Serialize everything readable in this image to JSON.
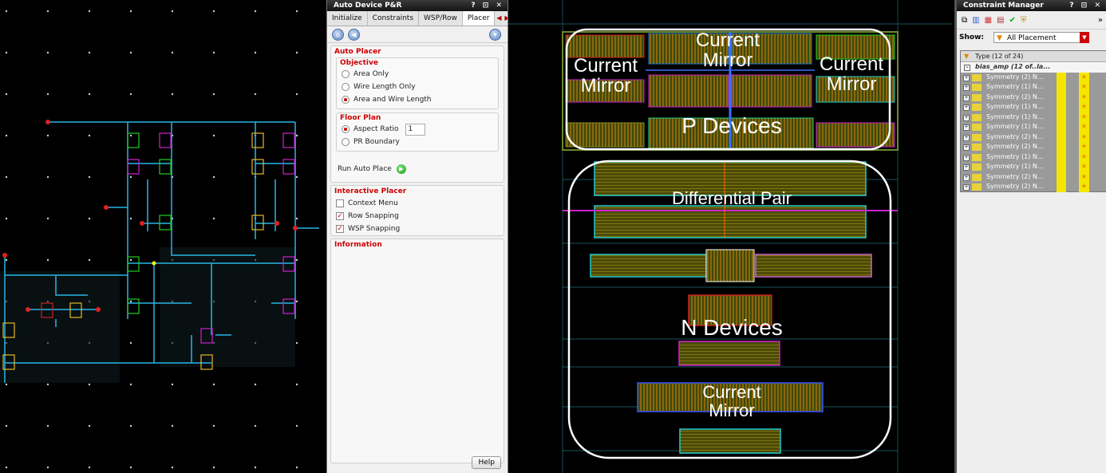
{
  "apr": {
    "title": "Auto Device P&R",
    "title_buttons": "? ⊡ ✕",
    "tabs": [
      "Initialize",
      "Constraints",
      "WSP/Row",
      "Placer"
    ],
    "auto_placer_title": "Auto Placer",
    "objective_title": "Objective",
    "objective_options": [
      "Area Only",
      "Wire Length Only",
      "Area and Wire Length"
    ],
    "objective_selected": "Area and Wire Length",
    "floorplan_title": "Floor Plan",
    "aspect_ratio_label": "Aspect Ratio",
    "aspect_ratio_value": "1",
    "pr_boundary_label": "PR Boundary",
    "run_label": "Run Auto Place",
    "interactive_title": "Interactive Placer",
    "context_menu_label": "Context Menu",
    "row_snapping_label": "Row Snapping",
    "wsp_snapping_label": "WSP Snapping",
    "information_title": "Information",
    "help_label": "Help"
  },
  "layout": {
    "labels": {
      "current_mirror_top": "Current Mirror",
      "current_mirror_left": "Current Mirror",
      "current_mirror_right": "Current Mirror",
      "p_devices": "P Devices",
      "differential_pair": "Differential Pair",
      "n_devices": "N Devices",
      "current_mirror_bottom": "Current Mirror"
    }
  },
  "cm": {
    "title": "Constraint Manager",
    "title_buttons": "? ⊡ ✕",
    "show_label": "Show:",
    "show_value": "All Placement",
    "header_type": "Type (12 of 24)",
    "top_row": "bias_amp (12 of..la...",
    "rows": [
      "Symmetry (2)  N...",
      "Symmetry (1)  N...",
      "Symmetry (2)  N...",
      "Symmetry (1)  N...",
      "Symmetry (1)  N...",
      "Symmetry (1)  N...",
      "Symmetry (2)  N...",
      "Symmetry (2)  N...",
      "Symmetry (1)  N...",
      "Symmetry (1)  N...",
      "Symmetry (2)  N...",
      "Symmetry (2)  N..."
    ]
  },
  "colors": {
    "wire": "#29b6e8",
    "panel_accent": "#cc0000",
    "pfet_a": "#22cc22",
    "pfet_b": "#cc22cc",
    "gold": "#e8b828"
  }
}
